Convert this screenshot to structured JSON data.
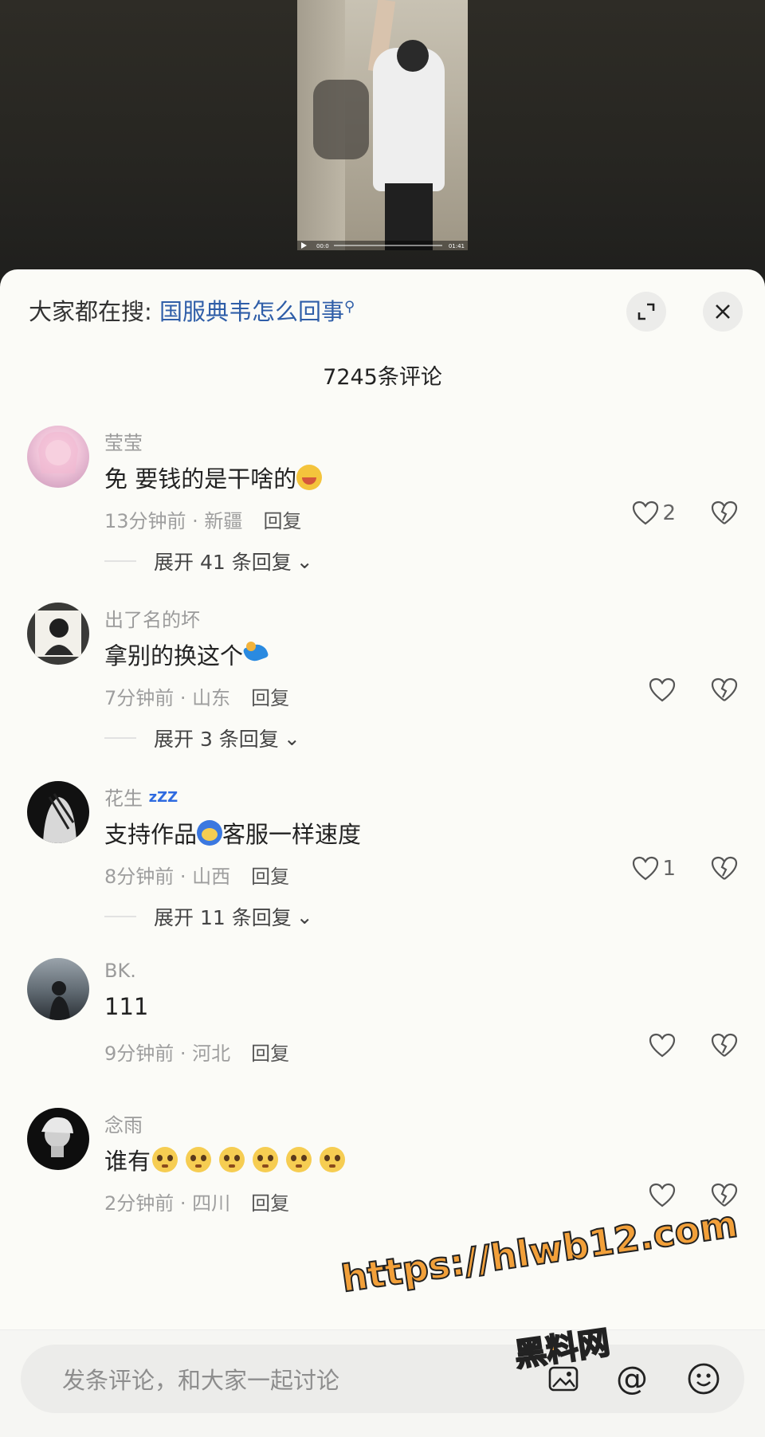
{
  "video": {
    "time_current": "00:0",
    "time_total": "01:41"
  },
  "header": {
    "search_prefix": "大家都在搜: ",
    "search_keyword": "国服典韦怎么回事",
    "comment_count": "7245条评论"
  },
  "comments": [
    {
      "user": "莹莹",
      "text": "免 要钱的是干啥的",
      "time": "13分钟前 · 新疆",
      "reply": "回复",
      "likes": "2",
      "expand": "展开 41 条回复"
    },
    {
      "user": "出了名的坏",
      "text": "拿别的换这个",
      "time": "7分钟前 · 山东",
      "reply": "回复",
      "likes": "",
      "expand": "展开 3 条回复"
    },
    {
      "user": "花生",
      "user_badge": "zZZ",
      "text_a": "支持作品",
      "text_b": "客服一样速度",
      "time": "8分钟前 · 山西",
      "reply": "回复",
      "likes": "1",
      "expand": "展开 11 条回复"
    },
    {
      "user": "BK.",
      "text": "111",
      "time": "9分钟前 · 河北",
      "reply": "回复",
      "likes": ""
    },
    {
      "user": "念雨",
      "text": "谁有",
      "time": "2分钟前 · 四川",
      "reply": "回复",
      "likes": ""
    }
  ],
  "input": {
    "placeholder": "发条评论，和大家一起讨论",
    "at": "@"
  },
  "watermark": {
    "url": "https://hlwb12.com",
    "name": "黑料网"
  },
  "icons": {
    "like": "heart-icon",
    "dislike": "broken-heart-icon",
    "close": "close-icon",
    "expand": "expand-icon",
    "image": "image-icon",
    "emoji": "emoji-icon"
  }
}
